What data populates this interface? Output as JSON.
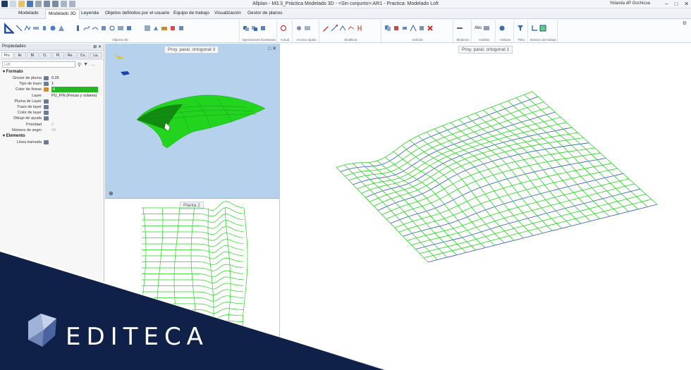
{
  "window": {
    "title": "Allplan - M3.3_Práctica Modelado 3D - <Sin conjunto>:AR1 - Practica: Modelado Loft",
    "user": "Yolanda dP Gochicoa"
  },
  "ribbon_tabs": [
    {
      "label": "Modelado",
      "active": false
    },
    {
      "label": "Modelado 3D",
      "active": true
    },
    {
      "label": "Leyenda",
      "active": false
    },
    {
      "label": "Objetos definidos por el usuario",
      "active": false
    },
    {
      "label": "Equipo de trabajo",
      "active": false
    },
    {
      "label": "Visualización",
      "active": false
    },
    {
      "label": "Gestor de planos",
      "active": false
    }
  ],
  "ribbon_groups": [
    "Objetos 3D",
    "Operaciones booleanas",
    "Actual.",
    "Acceso rápido",
    "Modificar",
    "Edición",
    "Medición",
    "Análisis",
    "Atributo",
    "Filtro",
    "Entorno de trabajo"
  ],
  "properties": {
    "title": "Propiedades",
    "tabs": [
      "Pro.",
      "Ar.",
      "Bl.",
      "O..",
      "Pl.",
      "Re..",
      "Co..",
      "La.."
    ],
    "filter_value": "Loft",
    "section_formato": "Formato",
    "rows": [
      {
        "label": "Grosor de pluma",
        "value": "0.25"
      },
      {
        "label": "Tipo de trazo",
        "value": "1"
      },
      {
        "label": "Color de líneas",
        "value": "6"
      },
      {
        "label": "Layer",
        "value": "PU_FIN (Fincas y solares)"
      },
      {
        "label": "Pluma de Layer",
        "value": ""
      },
      {
        "label": "Trazo de layer",
        "value": ""
      },
      {
        "label": "Color de layer",
        "value": ""
      },
      {
        "label": "Dibujo de ayuda",
        "value": ""
      },
      {
        "label": "Prioridad",
        "value": "0"
      },
      {
        "label": "Número de segm",
        "value": "43"
      }
    ],
    "section_elemento": "Elemento",
    "row_linea": {
      "label": "Línea tramada",
      "value": ""
    }
  },
  "viewports": {
    "top_left": "Proy. paral. ortogonal 3",
    "bottom_left": "Planta 2",
    "right": "Proy. paral. ortogonal 1"
  },
  "brand": {
    "name": "EDITECA"
  },
  "colors": {
    "mesh_green": "#23d41f",
    "mesh_blue": "#3a4bd8",
    "brand_navy": "#0f2148",
    "viewport_blue": "#b5d1ec"
  }
}
